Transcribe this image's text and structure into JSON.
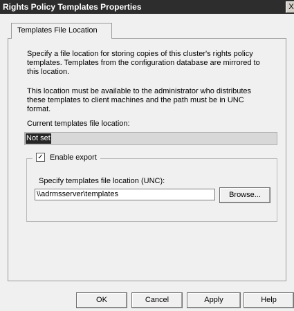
{
  "window": {
    "title": "Rights Policy Templates Properties",
    "close_glyph": "X"
  },
  "tabs": [
    {
      "label": "Templates File Location",
      "selected": true
    }
  ],
  "content": {
    "description_1": "Specify a file location for storing copies of this cluster's rights policy templates. Templates from the configuration database are mirrored to this location.",
    "description_2": "This location must be available to the administrator who distributes these templates to client machines and the path must be in UNC format.",
    "current_location_label": "Current templates file location:",
    "current_location_value": "Not set",
    "enable_export": {
      "label": "Enable export",
      "checked": true,
      "check_glyph": "✓"
    },
    "unc_label": "Specify templates file location (UNC):",
    "unc_value": "\\\\adrmsserver\\templates",
    "browse_label": "Browse..."
  },
  "footer_buttons": {
    "ok": "OK",
    "cancel": "Cancel",
    "apply": "Apply",
    "help": "Help"
  },
  "icons": {
    "close": "close-icon",
    "checkbox": "checkmark-icon"
  }
}
